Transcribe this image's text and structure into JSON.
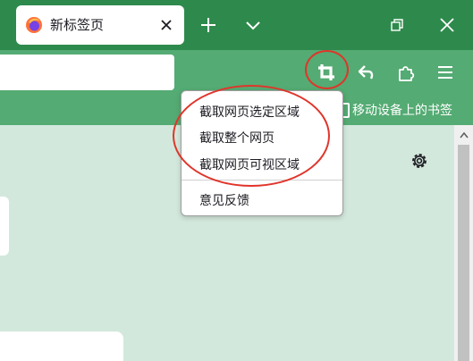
{
  "tab": {
    "title": "新标签页"
  },
  "bookmarks": {
    "mobile_label": "移动设备上的书签"
  },
  "menu": {
    "items": [
      "截取网页选定区域",
      "截取整个网页",
      "截取网页可视区域"
    ],
    "feedback": "意见反馈"
  },
  "colors": {
    "titlebar": "#2e8a4c",
    "toolbar": "#54ab73",
    "content_bg": "#d3e8dc",
    "highlight_ring": "#e0352b"
  },
  "icons": {
    "favicon": "firefox-icon",
    "tab_close": "close-icon",
    "new_tab": "plus-icon",
    "list_tabs": "chevron-down-icon",
    "restore": "restore-window-icon",
    "window_close": "close-window-icon",
    "screenshot": "crop-icon",
    "back": "undo-arrow-icon",
    "extensions": "puzzle-icon",
    "menu": "hamburger-menu-icon",
    "settings": "gear-icon"
  }
}
